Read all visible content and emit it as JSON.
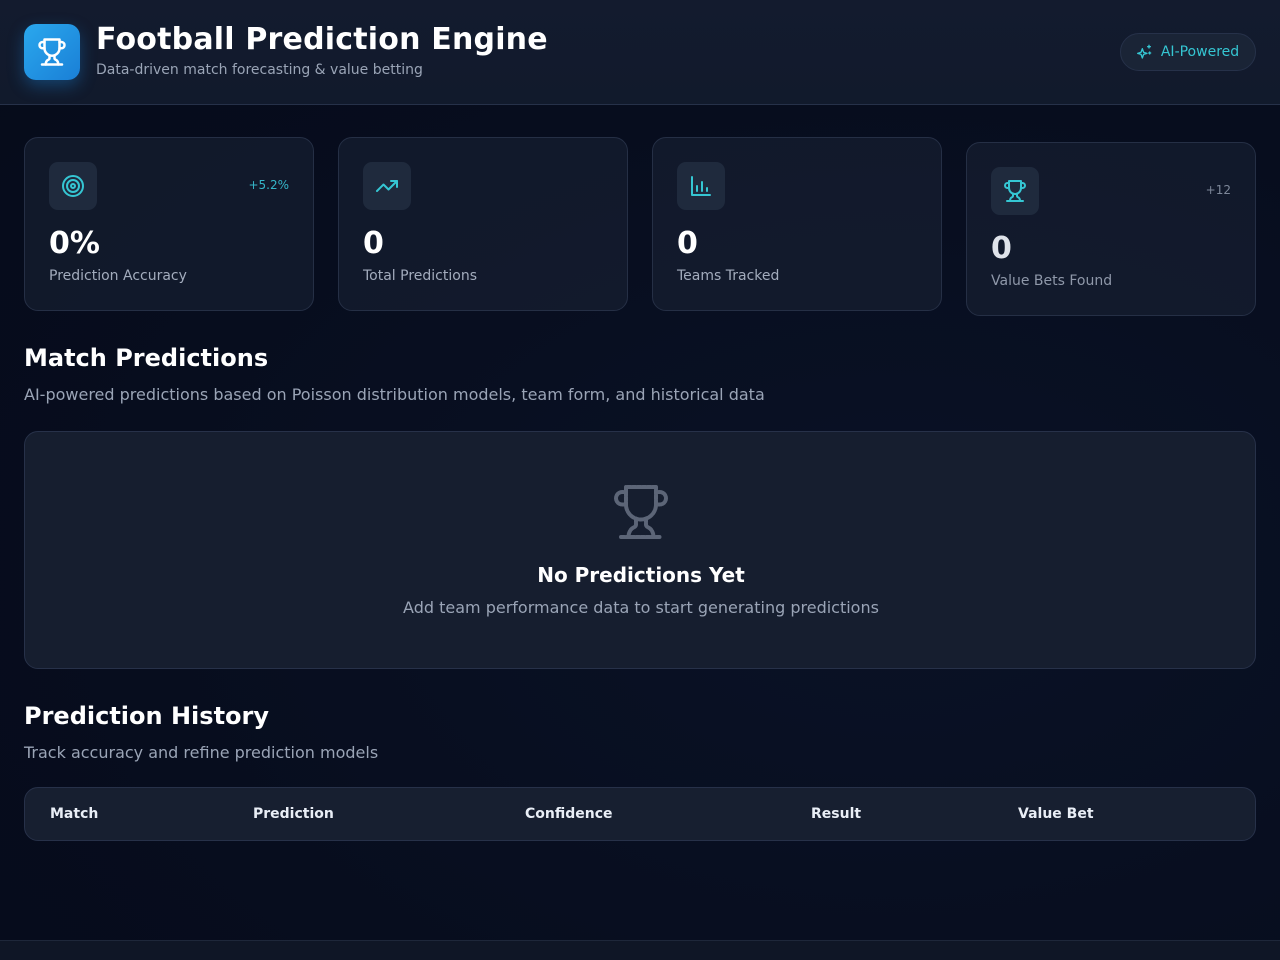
{
  "header": {
    "title": "Football Prediction Engine",
    "subtitle": "Data-driven match forecasting & value betting",
    "badge": "AI-Powered",
    "logo_icon": "trophy-icon",
    "badge_icon": "sparkles-icon"
  },
  "stats": [
    {
      "icon": "target-icon",
      "value": "0%",
      "label": "Prediction Accuracy",
      "delta": "+5.2%"
    },
    {
      "icon": "trending-up-icon",
      "value": "0",
      "label": "Total Predictions",
      "delta": ""
    },
    {
      "icon": "bar-chart-icon",
      "value": "0",
      "label": "Teams Tracked",
      "delta": ""
    },
    {
      "icon": "trophy-icon",
      "value": "0",
      "label": "Value Bets Found",
      "delta": "+12"
    }
  ],
  "predictions": {
    "title": "Match Predictions",
    "subtitle": "AI-powered predictions based on Poisson distribution models, team form, and historical data",
    "empty_title": "No Predictions Yet",
    "empty_subtitle": "Add team performance data to start generating predictions"
  },
  "history": {
    "title": "Prediction History",
    "subtitle": "Track accuracy and refine prediction models",
    "columns": [
      "Match",
      "Prediction",
      "Confidence",
      "Result",
      "Value Bet"
    ]
  },
  "colors": {
    "accent": "#35c6d3",
    "logo_gradient_start": "#2aa8ee",
    "logo_gradient_end": "#1a7fd6",
    "background": "#070d1e"
  }
}
